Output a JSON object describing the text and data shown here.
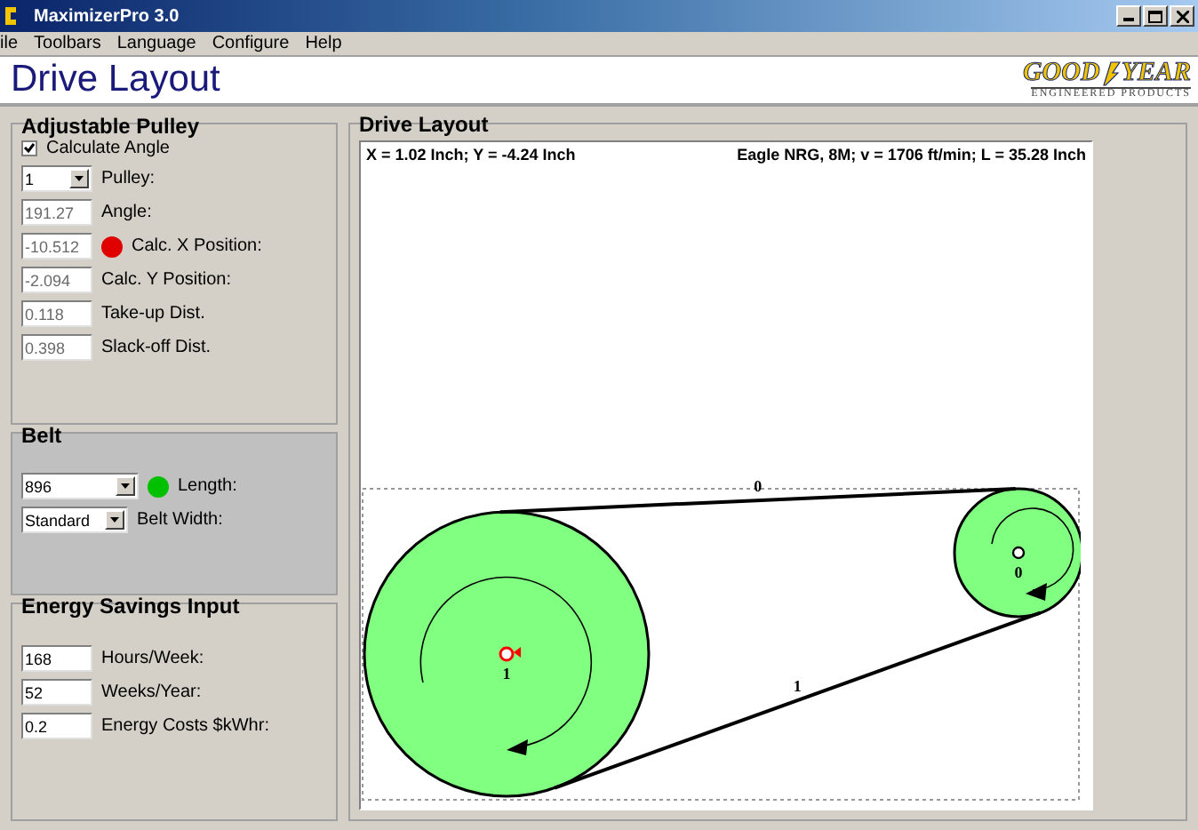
{
  "window": {
    "title": "MaximizerPro 3.0"
  },
  "menu": [
    "ile",
    "Toolbars",
    "Language",
    "Configure",
    "Help"
  ],
  "header": {
    "title": "Drive Layout",
    "logo_left": "GOOD",
    "logo_right": "YEAR",
    "logo_sub": "ENGINEERED PRODUCTS"
  },
  "adjustable_pulley": {
    "title": "Adjustable Pulley",
    "calculate_angle": {
      "label": "Calculate Angle",
      "checked": true
    },
    "fields": [
      {
        "kind": "select",
        "value": "1",
        "label": "Pulley:",
        "disabled": false
      },
      {
        "kind": "text",
        "value": "191.27",
        "label": "Angle:",
        "disabled": true
      },
      {
        "kind": "indicator",
        "value": "-10.512",
        "label": "Calc. X Position:",
        "disabled": true,
        "color": "#e00000"
      },
      {
        "kind": "text",
        "value": "-2.094",
        "label": "Calc. Y Position:",
        "disabled": true
      },
      {
        "kind": "text",
        "value": "0.118",
        "label": "Take-up Dist.",
        "disabled": true
      },
      {
        "kind": "text",
        "value": "0.398",
        "label": "Slack-off Dist.",
        "disabled": true
      }
    ]
  },
  "belt": {
    "title": "Belt",
    "fields": [
      {
        "kind": "select_indicator",
        "value": "896",
        "label": "Length:",
        "color": "#00c000"
      },
      {
        "kind": "select",
        "value": "Standard",
        "label": "Belt Width:"
      }
    ]
  },
  "energy": {
    "title": "Energy Savings Input",
    "fields": [
      {
        "value": "168",
        "label": "Hours/Week:"
      },
      {
        "value": "52",
        "label": "Weeks/Year:"
      },
      {
        "value": "0.2",
        "label": "Energy Costs $kWhr:"
      }
    ]
  },
  "drive_layout": {
    "title": "Drive Layout",
    "coordinates": "X = 1.02 Inch; Y = -4.24 Inch",
    "info": "Eagle NRG, 8M; v = 1706 ft/min; L = 35.28 Inch",
    "pulleys": [
      {
        "label": "1",
        "selected": true
      },
      {
        "label": "0",
        "selected": false
      }
    ],
    "spans": [
      "0",
      "1"
    ]
  }
}
